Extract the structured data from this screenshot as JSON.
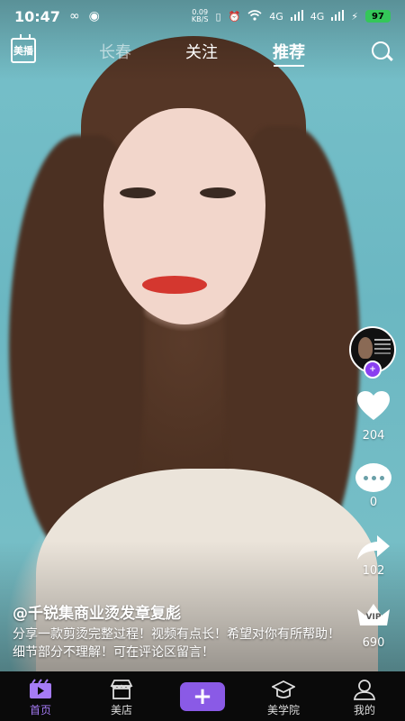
{
  "status_bar": {
    "time": "10:47",
    "left_icons": [
      "infinity-icon",
      "app-notification-icon"
    ],
    "net_speed_value": "0.09",
    "net_speed_unit": "KB/S",
    "signal_1": "4G",
    "signal_2": "4G",
    "battery": "97"
  },
  "top_nav": {
    "logo": "美播",
    "tabs": [
      {
        "label": "长春",
        "active": false
      },
      {
        "label": "关注",
        "active": false
      },
      {
        "label": "推荐",
        "active": true
      }
    ]
  },
  "actions": {
    "follow_badge": "+",
    "like_count": "204",
    "comment_count": "0",
    "share_count": "102",
    "vip_label": "VIP",
    "vip_count": "690"
  },
  "post": {
    "author": "@千锐集商业烫发章复彪",
    "description": "分享一款剪烫完整过程！视频有点长！希望对你有所帮助！细节部分不理解！可在评论区留言！"
  },
  "tab_bar": {
    "items": [
      {
        "label": "首页",
        "icon": "video-icon",
        "active": true
      },
      {
        "label": "美店",
        "icon": "store-icon",
        "active": false
      },
      {
        "label": "+",
        "icon": "plus-icon",
        "active": false
      },
      {
        "label": "美学院",
        "icon": "graduation-cap-icon",
        "active": false
      },
      {
        "label": "我的",
        "icon": "user-icon",
        "active": false
      }
    ]
  },
  "colors": {
    "accent": "#8a5ae6",
    "active_tab": "#a57bf5",
    "battery": "#34c759"
  }
}
